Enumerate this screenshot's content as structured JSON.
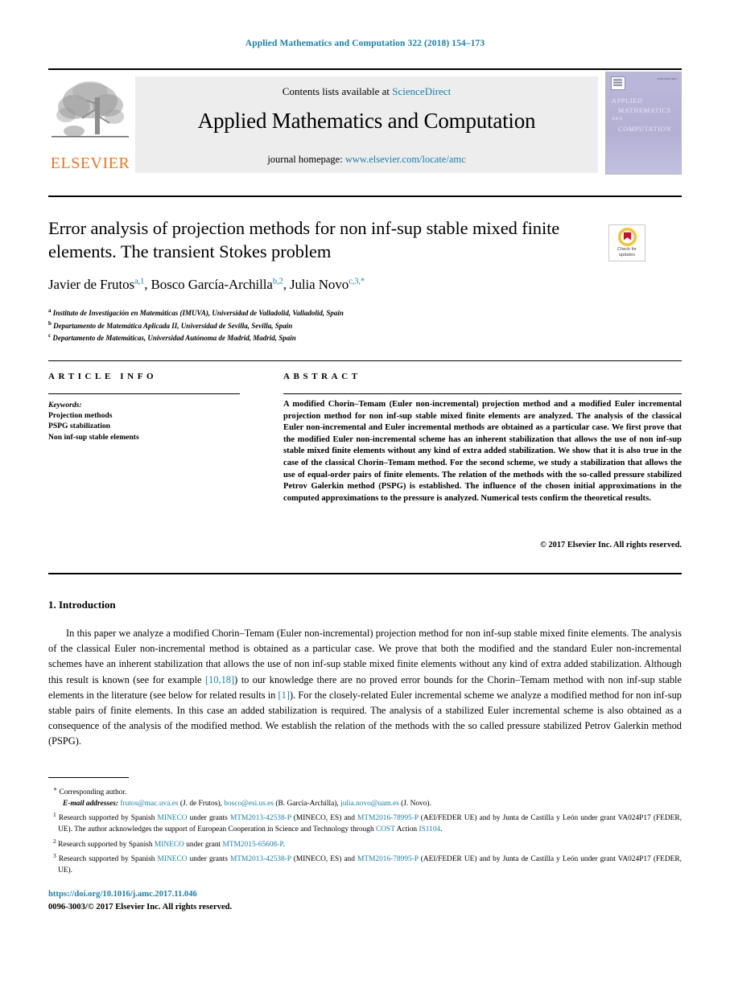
{
  "running_head": "Applied Mathematics and Computation 322 (2018) 154–173",
  "masthead": {
    "contents_prefix": "Contents lists available at ",
    "contents_link": "ScienceDirect",
    "journal_name": "Applied Mathematics and Computation",
    "homepage_prefix": "journal homepage: ",
    "homepage_url": "www.elsevier.com/locate/amc",
    "publisher_wordmark": "ELSEVIER",
    "cover": {
      "line1": "APPLIED",
      "line2": "MATHEMATICS",
      "line3": "AND",
      "line4": "COMPUTATION",
      "corner_text": "ISSN 0096-3003"
    }
  },
  "article": {
    "title": "Error analysis of projection methods for non inf-sup stable mixed finite elements. The transient Stokes problem",
    "authors_html": "Javier de Frutos<sup>a,1</sup>, Bosco García-Archilla<sup>b,2</sup>, Julia Novo<sup>c,3,*</sup>",
    "affiliations": [
      {
        "mark": "a",
        "text": "Instituto de Investigación en Matemáticas (IMUVA), Universidad de Valladolid, Valladolid, Spain"
      },
      {
        "mark": "b",
        "text": "Departamento de Matemática Aplicada II, Universidad de Sevilla, Sevilla, Spain"
      },
      {
        "mark": "c",
        "text": "Departamento de Matemáticas, Universidad Autónoma de Madrid, Madrid, Spain"
      }
    ],
    "crossmark": {
      "line1": "Check for",
      "line2": "updates"
    }
  },
  "info": {
    "heading": "ARTICLE INFO",
    "keywords_label": "Keywords:",
    "keywords": [
      "Projection methods",
      "PSPG stabilization",
      "Non inf-sup stable elements"
    ]
  },
  "abstract": {
    "heading": "ABSTRACT",
    "text": "A modified Chorin–Temam (Euler non-incremental) projection method and a modified Euler incremental projection method for non inf-sup stable mixed finite elements are analyzed. The analysis of the classical Euler non-incremental and Euler incremental methods are obtained as a particular case. We first prove that the modified Euler non-incremental scheme has an inherent stabilization that allows the use of non inf-sup stable mixed finite elements without any kind of extra added stabilization. We show that it is also true in the case of the classical Chorin–Temam method. For the second scheme, we study a stabilization that allows the use of equal-order pairs of finite elements. The relation of the methods with the so-called pressure stabilized Petrov Galerkin method (PSPG) is established. The influence of the chosen initial approximations in the computed approximations to the pressure is analyzed. Numerical tests confirm the theoretical results.",
    "copyright": "© 2017 Elsevier Inc. All rights reserved."
  },
  "introduction": {
    "heading": "1. Introduction",
    "part1": "In this paper we analyze a modified Chorin–Temam (Euler non-incremental) projection method for non inf-sup stable mixed finite elements. The analysis of the classical Euler non-incremental method is obtained as a particular case. We prove that both the modified and the standard Euler non-incremental schemes have an inherent stabilization that allows the use of non inf-sup stable mixed finite elements without any kind of extra added stabilization. Although this result is known (see for example ",
    "cite1": "[10,18]",
    "part2": ") to our knowledge there are no proved error bounds for the Chorin–Temam method with non inf-sup stable elements in the literature (see below for related results in ",
    "cite2": "[1]",
    "part3": "). For the closely-related Euler incremental scheme we analyze a modified method for non inf-sup stable pairs of finite elements. In this case an added stabilization is required. The analysis of a stabilized Euler incremental scheme is also obtained as a consequence of the analysis of the modified method. We establish the relation of the methods with the so called pressure stabilized Petrov Galerkin method (PSPG)."
  },
  "footnotes": {
    "corresponding": "Corresponding author.",
    "email_label": "E-mail addresses:",
    "emails": [
      {
        "address": "frutos@mac.uva.es",
        "owner": "(J. de Frutos),"
      },
      {
        "address": "bosco@esi.us.es",
        "owner": "(B. García-Archilla),"
      },
      {
        "address": "julia.novo@uam.es",
        "owner": "(J. Novo)."
      }
    ],
    "note1": {
      "mark": "1",
      "t1": "Research supported by Spanish ",
      "agency": "MINECO",
      "t2": " under grants ",
      "grant1": "MTM2013-42538-P",
      "t3": " (MINECO, ES) and ",
      "grant2": "MTM2016-78995-P",
      "t4": " (AEI/FEDER UE) and by Junta de Castilla y León under grant VA024P17 (FEDER, UE). The author acknowledges the support of European Cooperation in Science and Technology through ",
      "cost": "COST",
      "t5": " Action ",
      "action": "IS1104",
      "t6": "."
    },
    "note2": {
      "mark": "2",
      "t1": "Research supported by Spanish ",
      "agency": "MINECO",
      "t2": " under grant ",
      "grant1": "MTM2015-65608-P",
      "t3": "."
    },
    "note3": {
      "mark": "3",
      "t1": "Research supported by Spanish ",
      "agency": "MINECO",
      "t2": " under grants ",
      "grant1": "MTM2013-42538-P",
      "t3": " (MINECO, ES) and ",
      "grant2": "MTM2016-78995-P",
      "t4": " (AEI/FEDER UE) and by Junta de Castilla y León under grant VA024P17 (FEDER, UE)."
    }
  },
  "doi": "https://doi.org/10.1016/j.amc.2017.11.046",
  "issn_line": "0096-3003/© 2017 Elsevier Inc. All rights reserved."
}
